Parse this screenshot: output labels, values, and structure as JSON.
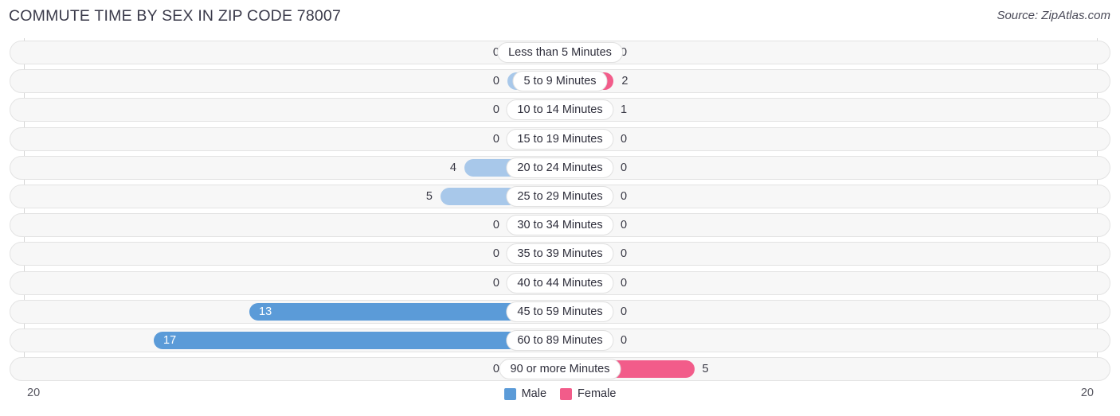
{
  "header": {
    "title": "COMMUTE TIME BY SEX IN ZIP CODE 78007",
    "source": "Source: ZipAtlas.com"
  },
  "legend": {
    "items": [
      {
        "label": "Male",
        "color": "#5b9bd8"
      },
      {
        "label": "Female",
        "color": "#f25c8a"
      }
    ]
  },
  "axis": {
    "left_end": "20",
    "right_end": "20"
  },
  "chart_data": {
    "type": "bar",
    "subtype": "diverging-horizontal",
    "title": "Commute Time by Sex in Zip Code 78007",
    "xlabel": "",
    "ylabel": "",
    "xlim": [
      20,
      20
    ],
    "grid": false,
    "legend_position": "bottom-center",
    "categories": [
      "Less than 5 Minutes",
      "5 to 9 Minutes",
      "10 to 14 Minutes",
      "15 to 19 Minutes",
      "20 to 24 Minutes",
      "25 to 29 Minutes",
      "30 to 34 Minutes",
      "35 to 39 Minutes",
      "40 to 44 Minutes",
      "45 to 59 Minutes",
      "60 to 89 Minutes",
      "90 or more Minutes"
    ],
    "series": [
      {
        "name": "Male",
        "direction": "left",
        "values": [
          0,
          0,
          0,
          0,
          4,
          5,
          0,
          0,
          0,
          13,
          17,
          0
        ],
        "labels": [
          "0",
          "0",
          "0",
          "0",
          "4",
          "5",
          "0",
          "0",
          "0",
          "13",
          "17",
          "0"
        ]
      },
      {
        "name": "Female",
        "direction": "right",
        "values": [
          0,
          2,
          1,
          0,
          0,
          0,
          0,
          0,
          0,
          0,
          0,
          5
        ],
        "labels": [
          "0",
          "2",
          "1",
          "0",
          "0",
          "0",
          "0",
          "0",
          "0",
          "0",
          "0",
          "5"
        ]
      }
    ]
  }
}
